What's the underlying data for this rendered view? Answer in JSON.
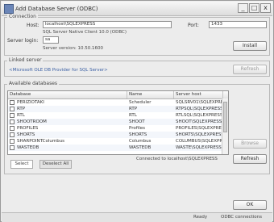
{
  "window": {
    "title": "Add Database Server (ODBC)",
    "controls": {
      "minimize": "_",
      "maximize": "□",
      "close": "x"
    }
  },
  "connection": {
    "legend": "Connection",
    "host_label": "Host:",
    "host_value": "localhost\\SQLEXPRESS",
    "port_label": "Port:",
    "port_value": "1433",
    "driver_note": "SQL Server Native Client 10.0 (ODBC)",
    "user_label": "Server login:",
    "user_value": "sa",
    "version_note": "Server version: 10.50.1600",
    "install_button": "Install"
  },
  "link_section": {
    "legend": "Linked server",
    "text": "<Microsoft OLE DB Provider for SQL Server>",
    "button": "Refresh"
  },
  "databases": {
    "legend": "Available databases",
    "columns": [
      "Database",
      "Name",
      "Server host"
    ],
    "rows": [
      {
        "db": "PERIZIOTAKI",
        "name": "Scheduler",
        "host": "SQLSRV01\\SQLEXPRESS"
      },
      {
        "db": "RTP",
        "name": "RTP",
        "host": "RTPSQL\\SQLEXPRESS"
      },
      {
        "db": "RTL",
        "name": "RTL",
        "host": "RTLSQL\\SQLEXPRESS"
      },
      {
        "db": "SHOOTROOM",
        "name": "SHOOT",
        "host": "SHOOT\\SQLEXPRESS"
      },
      {
        "db": "PROFILES",
        "name": "Profiles",
        "host": "PROFILES\\SQLEXPRESS"
      },
      {
        "db": "SHORTS",
        "name": "SHORTS",
        "host": "SHORTS\\SQLEXPRESS"
      },
      {
        "db": "SHARPOINTColumbus",
        "name": "Columbus",
        "host": "COLUMBUS\\SQLEXPRESS"
      },
      {
        "db": "WASTEDB",
        "name": "WASTEDB",
        "host": "WASTE\\SQLEXPRESS"
      }
    ],
    "footer_text": "Connected to localhost\\SQLEXPRESS",
    "tabs": [
      "Select",
      "Deselect All"
    ],
    "side_buttons": [
      "Browse",
      "Refresh"
    ]
  },
  "footer": {
    "ok_button": "OK",
    "status_left": "Ready",
    "status_right": "ODBC connections"
  }
}
